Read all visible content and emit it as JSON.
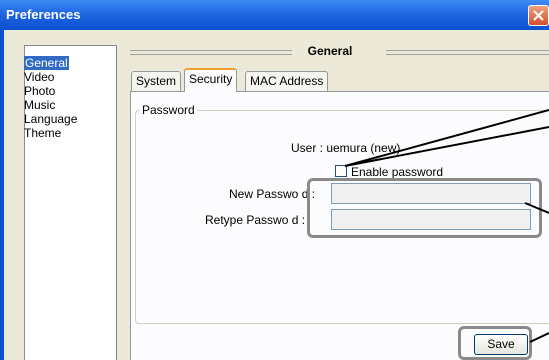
{
  "window": {
    "title": "Preferences"
  },
  "sidebar": {
    "items": [
      {
        "label": "General",
        "selected": true
      },
      {
        "label": "Video"
      },
      {
        "label": "Photo"
      },
      {
        "label": "Music"
      },
      {
        "label": "Language"
      },
      {
        "label": "Theme"
      }
    ]
  },
  "section": {
    "title": "General"
  },
  "tabs": [
    {
      "label": "System"
    },
    {
      "label": "Security",
      "active": true
    },
    {
      "label": "MAC Address"
    }
  ],
  "password_group": {
    "legend": "Password",
    "user_text": "User : uemura (new)",
    "enable_label": "Enable password",
    "enable_checked": false,
    "new_password_label": "New Passwo d :",
    "retype_password_label": "Retype Passwo d :",
    "new_password_value": "",
    "retype_password_value": ""
  },
  "buttons": {
    "save": "Save"
  },
  "colors": {
    "title_bar": "#1f66e0",
    "highlight_outline": "#8a8a8a",
    "selection": "#316ac5"
  }
}
